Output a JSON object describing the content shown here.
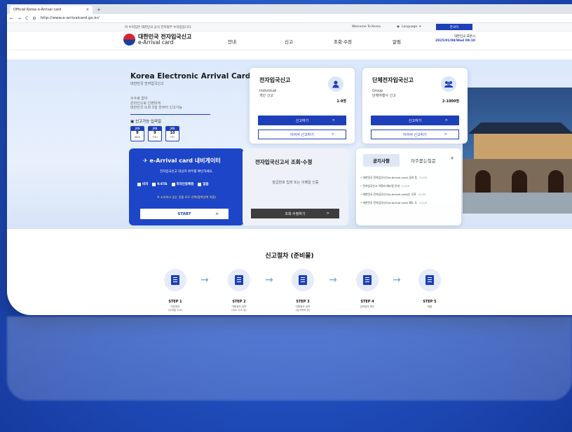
{
  "browser": {
    "tab_title": "Official Korea e-Arrival card",
    "tab_close": "×",
    "new_tab": "+",
    "url": "http://www.e-arrivalcard.go.kr/"
  },
  "util": {
    "notice": "이 누리집은 대한민국 공식 전자정부 누리집입니다.",
    "welcome": "Welcome To Korea",
    "language_label": "Language",
    "language_current": "한국어"
  },
  "header": {
    "logo_kr": "대한민국 전자입국신고",
    "logo_en": "e-Arrival card",
    "nav": [
      "안내",
      "신고",
      "조회·수정",
      "알림"
    ],
    "date_label": "대한민국 표준시",
    "date_value": "2025/01/08/Wed 09:10"
  },
  "hero": {
    "title": "Korea Electronic Arrival Card",
    "subtitle": "대한민국 전자입국신고",
    "desc": [
      "수수료 없이",
      "온라인으로 간편하게",
      "대한민국 도착 3일 전부터 신고가능"
    ],
    "avail_label": "신고가능 입국일",
    "dates": [
      {
        "m": "JAN",
        "n": "8",
        "w": "WED"
      },
      {
        "m": "JAN",
        "n": "9",
        "w": "THU"
      },
      {
        "m": "JAN",
        "n": "10",
        "w": "FRI"
      }
    ]
  },
  "individual": {
    "title": "전자입국신고",
    "sub1": "Individual",
    "sub2": "개인 신고",
    "count": "1-9명",
    "btn_new": "신고하기",
    "btn_continue": "이어서 신고하기"
  },
  "group": {
    "title": "단체전자입국신고",
    "sub1": "Group",
    "sub2": "단체여행사 신고",
    "count": "2-1000명",
    "btn_new": "신고하기",
    "btn_continue": "이어서 신고하기"
  },
  "navigator": {
    "title": "e-Arrival card 내비게이터",
    "subtitle": "전자입국신고 대상자 여부를 확인하세요.",
    "options": [
      "비자",
      "K-ETA",
      "외국인등록증",
      "없음"
    ],
    "note": "※ 소지하고 있는 것을 모두 선택(중복선택 허용)",
    "start": "START"
  },
  "query": {
    "title": "전자입국신고서 조회·수정",
    "desc": "발급번호 입력 또는 이메일 인증",
    "button": "조회·수정하기"
  },
  "notices": {
    "tab_active": "공지사항",
    "tab_other": "자주묻는질문",
    "more": "+",
    "items": [
      {
        "text": "대한민국 전자입국신고(e-Arrival card) 공지 등",
        "date": "01/08"
      },
      {
        "text": "전자입국신고 이용자 매뉴얼 안내",
        "date": "01/08"
      },
      {
        "text": "대한민국 전자입국신고(e-Arrival card)는 무료",
        "date": "01/08"
      },
      {
        "text": "대한민국 전자입국신고(e-Arrival card) 제도 도",
        "date": "01/08"
      }
    ]
  },
  "steps": {
    "title": "신고절차 (준비물)",
    "items": [
      {
        "label": "STEP 1",
        "desc": "여권정보\n(이메일 주소)"
      },
      {
        "label": "STEP 2",
        "desc": "여행정보 입력\n(숙소 주소 등)"
      },
      {
        "label": "STEP 3",
        "desc": "여행정보 입력\n(입국목적 등)"
      },
      {
        "label": "STEP 4",
        "desc": "입력정보 확인"
      },
      {
        "label": "STEP 5",
        "desc": "제출"
      }
    ]
  }
}
